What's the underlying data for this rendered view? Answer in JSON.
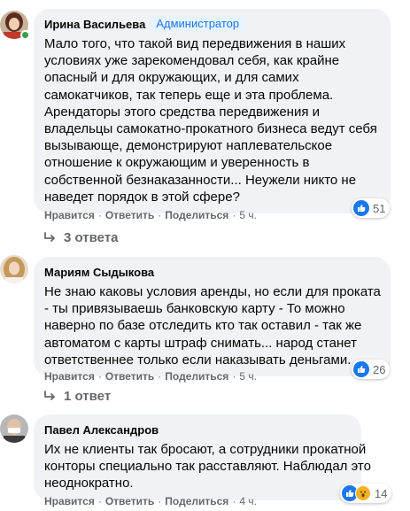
{
  "comments": [
    {
      "author": "Ирина Васильева",
      "badge": "Администратор",
      "text_lines": [
        "Мало того, что такой вид передвижения в наших",
        "условиях уже зарекомендовал себя, как крайне",
        "опасный и для окружающих, и для самих",
        "самокатчиков, так теперь еще и эта проблема.",
        "Арендаторы этого средства передвижения и",
        "владельцы самокатно-прокатного бизнеса ведут себя",
        "вызывающе, демонстрируют наплевательское",
        "отношение к окружающим и уверенность в",
        "собственной безнаказанности... Неужели никто не",
        "наведет порядок в этой сфере?"
      ],
      "like_label": "Нравится",
      "reply_label": "Ответить",
      "share_label": "Поделиться",
      "time": "5 ч.",
      "reaction_count": "51",
      "reactions": [
        "like"
      ],
      "replies_label": "3 ответа",
      "online": true
    },
    {
      "author": "Мариям Сыдыкова",
      "badge": "",
      "text_lines": [
        "Не знаю каковы условия аренды, но если для проката",
        "- ты привязываешь банковскую карту - То можно",
        "наверно по базе отследить кто так оставил - так же",
        "автоматом с карты штраф снимать... народ станет",
        "ответственнее только если наказывать деньгами."
      ],
      "like_label": "Нравится",
      "reply_label": "Ответить",
      "share_label": "Поделиться",
      "time": "5 ч.",
      "reaction_count": "26",
      "reactions": [
        "like"
      ],
      "replies_label": "1 ответ",
      "online": false
    },
    {
      "author": "Павел Александров",
      "badge": "",
      "text_lines": [
        "Их не клиенты так бросают, а сотрудники прокатной",
        "конторы специально так расставляют. Наблюдал это",
        "неоднократно."
      ],
      "like_label": "Нравится",
      "reply_label": "Ответить",
      "share_label": "Поделиться",
      "time": "4 ч.",
      "reaction_count": "14",
      "reactions": [
        "like",
        "wow"
      ],
      "replies_label": "",
      "online": false
    }
  ],
  "colors": {
    "bubble": "#f0f2f5",
    "meta_text": "#65676b",
    "like_blue": "#1877f2",
    "online_green": "#31a24c"
  }
}
